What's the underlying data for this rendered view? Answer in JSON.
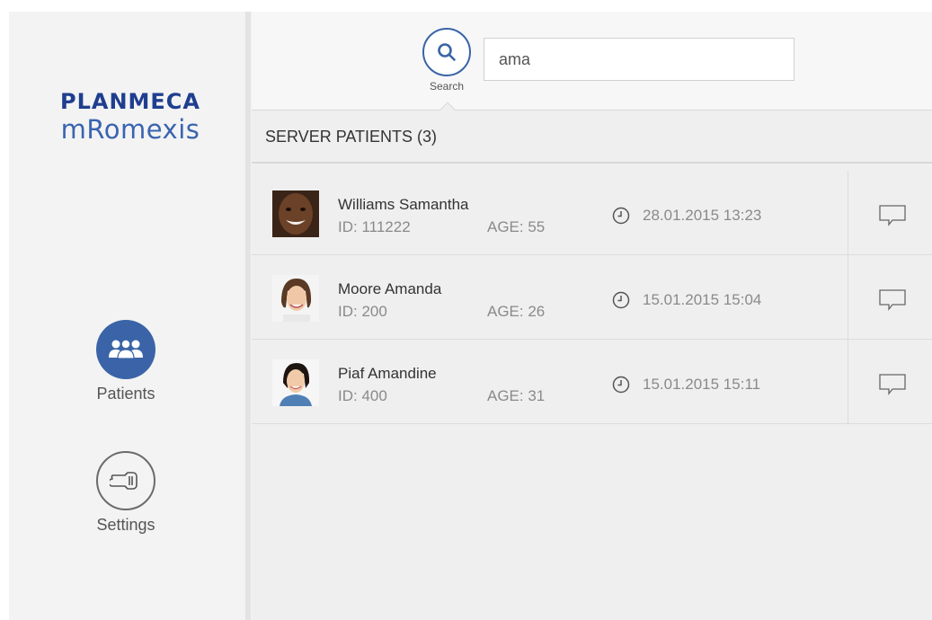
{
  "brand": {
    "line1": "PLANMECA",
    "line2": "mRomexis"
  },
  "nav": {
    "patients": {
      "label": "Patients",
      "icon": "people-icon",
      "active": true
    },
    "settings": {
      "label": "Settings",
      "icon": "wrench-icon",
      "active": false
    }
  },
  "search": {
    "label": "Search",
    "value": "ama",
    "icon": "search-icon"
  },
  "section": {
    "title": "SERVER PATIENTS (3)"
  },
  "patients": [
    {
      "name": "Williams Samantha",
      "id": "ID: 111222",
      "age": "AGE: 55",
      "date": "28.01.2015 13:23",
      "photo": "patient-photo"
    },
    {
      "name": "Moore Amanda",
      "id": "ID: 200",
      "age": "AGE: 26",
      "date": "15.01.2015 15:04",
      "photo": "patient-photo"
    },
    {
      "name": "Piaf Amandine",
      "id": "ID: 400",
      "age": "AGE: 31",
      "date": "15.01.2015 15:11",
      "photo": "patient-photo"
    }
  ],
  "colors": {
    "accent": "#3a64a7",
    "brand_dark": "#1f3e8f",
    "brand_light": "#3a64b0"
  }
}
